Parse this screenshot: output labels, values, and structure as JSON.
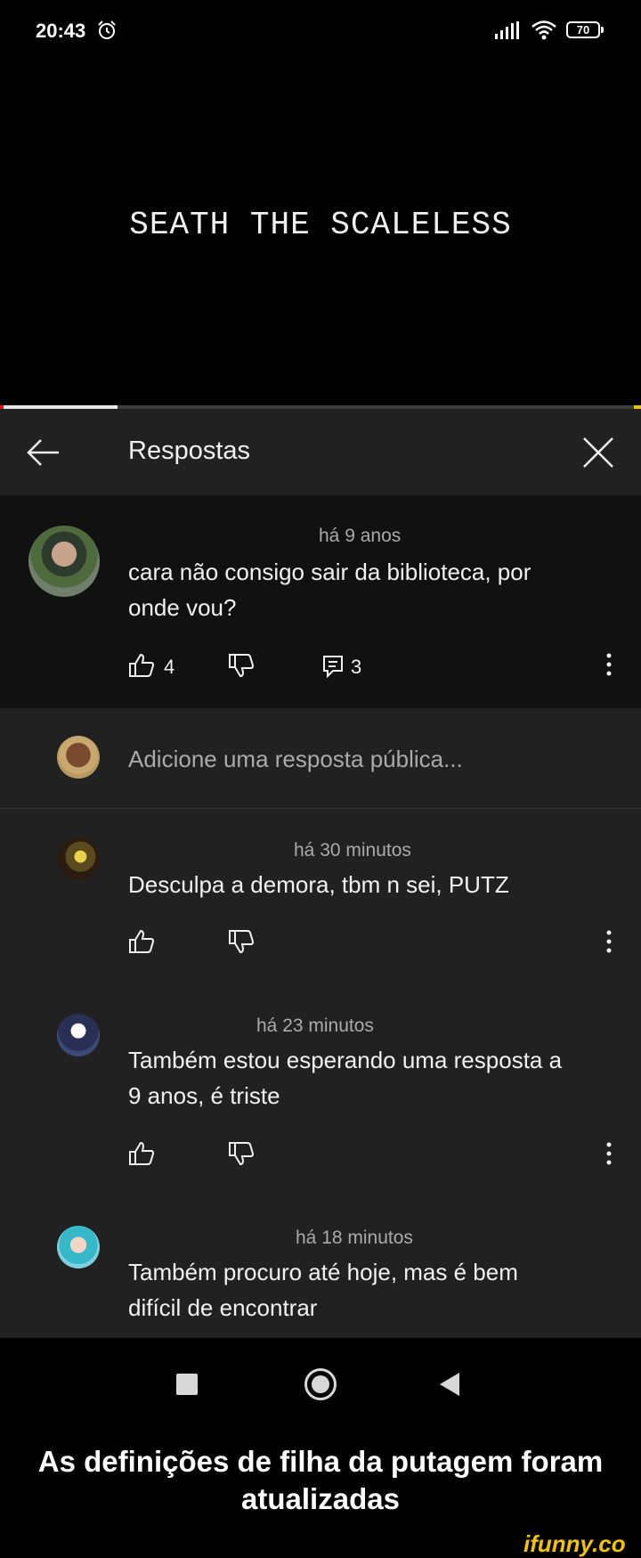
{
  "status_bar": {
    "time": "20:43",
    "battery": "70",
    "icons": [
      "alarm-icon",
      "signal-icon",
      "wifi-icon",
      "battery-icon"
    ]
  },
  "video": {
    "title": "SEATH THE SCALELESS"
  },
  "panel": {
    "title": "Respostas"
  },
  "original_comment": {
    "time": "há 9 anos",
    "text_line1": "cara não consigo sair da biblioteca, por",
    "text_line2": "onde vou?",
    "likes": "4",
    "replies": "3"
  },
  "reply_input": {
    "placeholder": "Adicione uma resposta pública..."
  },
  "replies": [
    {
      "time": "há 30 minutos",
      "text_line1": "Desculpa a demora, tbm n sei, PUTZ",
      "text_line2": ""
    },
    {
      "time": "há 23 minutos",
      "text_line1": "Também estou esperando uma resposta a",
      "text_line2": "9 anos, é triste"
    },
    {
      "time": "há 18 minutos",
      "text_line1": "Também procuro até hoje, mas é bem",
      "text_line2": "difícil de encontrar"
    }
  ],
  "caption": {
    "line1": "As definições de filha da putagem foram",
    "line2": "atualizadas"
  },
  "watermark": "ifunny.co",
  "colors": {
    "background": "#000000",
    "panel": "#212121",
    "op_block": "#111111",
    "meta_text": "#aaaaaa",
    "watermark": "#f4c300"
  }
}
